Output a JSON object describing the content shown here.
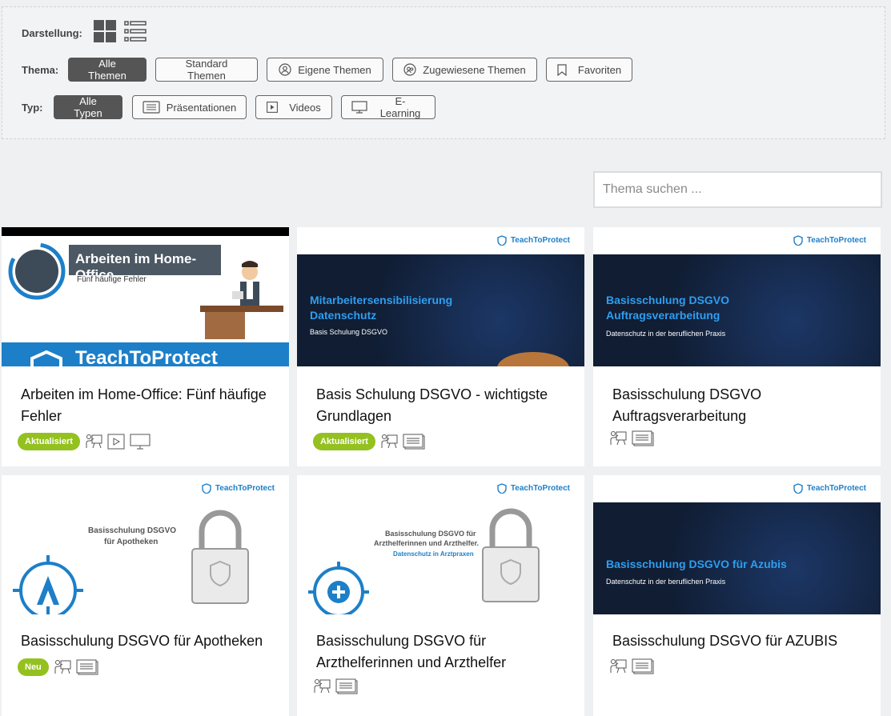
{
  "filters": {
    "view_label": "Darstellung:",
    "theme_label": "Thema:",
    "type_label": "Typ:",
    "themes": [
      "Alle Themen",
      "Standard Themen",
      "Eigene Themen",
      "Zugewiesene Themen",
      "Favoriten"
    ],
    "types": [
      "Alle Typen",
      "Präsentationen",
      "Videos",
      "E-Learning"
    ]
  },
  "search": {
    "placeholder": "Thema suchen ..."
  },
  "brand": {
    "logo_text": "TeachToProtect",
    "accent": "#2e9ef0",
    "badge_color": "#94c11f"
  },
  "cards": [
    {
      "title": "Arbeiten im Home-Office: Fünf häufige Fehler",
      "badge": "Aktualisiert",
      "thumb_title": "Arbeiten im Home-Office",
      "thumb_sub": "Fünf häufige Fehler",
      "thumb_logo_text": "TeachToProtect",
      "types": [
        "presenter-icon",
        "video-icon",
        "monitor-icon"
      ]
    },
    {
      "title": "Basis Schulung DSGVO - wichtigste Grundlagen",
      "badge": "Aktualisiert",
      "thumb_title": "Mitarbeitersensibilisierung Datenschutz",
      "thumb_sub": "Basis Schulung DSGVO",
      "types": [
        "presenter-icon",
        "slides-icon"
      ]
    },
    {
      "title": "Basisschulung DSGVO Auftragsverarbeitung",
      "badge": "",
      "thumb_title": "Basisschulung DSGVO Auftragsverarbeitung",
      "thumb_sub": "Datenschutz in der beruflichen Praxis",
      "types": [
        "presenter-icon",
        "slides-icon"
      ]
    },
    {
      "title": "Basisschulung DSGVO für Apotheken",
      "badge": "Neu",
      "thumb_title_a": "Basisschulung DSGVO",
      "thumb_title_b": "für Apotheken",
      "types": [
        "presenter-icon",
        "slides-icon"
      ]
    },
    {
      "title": "Basisschulung DSGVO für Arzthelferinnen und Arzthelfer",
      "badge": "",
      "thumb_title_a": "Basisschulung DSGVO für",
      "thumb_title_b": "Arzthelferinnen und Arzthelfer.",
      "thumb_sub": "Datenschutz in Arztpraxen",
      "types": [
        "presenter-icon",
        "slides-icon"
      ]
    },
    {
      "title": "Basisschulung DSGVO für AZUBIS",
      "badge": "",
      "thumb_title": "Basisschulung DSGVO für Azubis",
      "thumb_sub": "Datenschutz in der beruflichen Praxis",
      "types": [
        "presenter-icon",
        "slides-icon"
      ]
    }
  ]
}
